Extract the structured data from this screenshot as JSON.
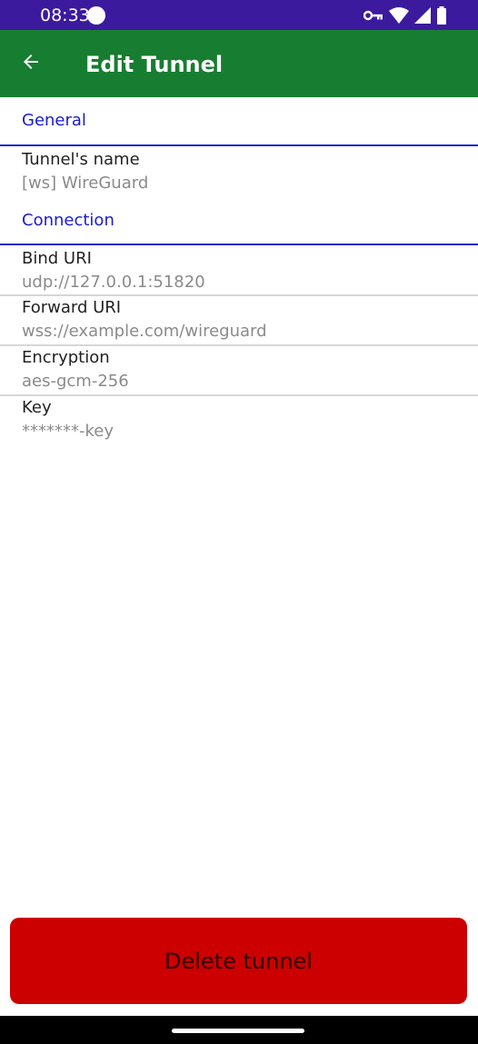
{
  "status_bar": {
    "time": "08:33",
    "icons": [
      "vpn-key-icon",
      "wifi-icon",
      "cell-signal-icon",
      "battery-icon"
    ]
  },
  "app_bar": {
    "title": "Edit Tunnel",
    "back_icon": "arrow-back-icon"
  },
  "sections": {
    "general": {
      "label": "General",
      "fields": {
        "tunnel_name": {
          "title": "Tunnel's name",
          "value": "[ws] WireGuard"
        }
      }
    },
    "connection": {
      "label": "Connection",
      "fields": {
        "bind_uri": {
          "title": "Bind URI",
          "value": "udp://127.0.0.1:51820"
        },
        "forward_uri": {
          "title": "Forward URI",
          "value": "wss://example.com/wireguard"
        },
        "encryption": {
          "title": "Encryption",
          "value": "aes-gcm-256"
        },
        "key": {
          "title": "Key",
          "value": "*******-key"
        }
      }
    }
  },
  "delete_button": {
    "label": "Delete tunnel"
  },
  "colors": {
    "status_bar": "#3b1a9e",
    "app_bar": "#177d30",
    "section_accent": "#1a1ad6",
    "delete": "#cc0000"
  }
}
